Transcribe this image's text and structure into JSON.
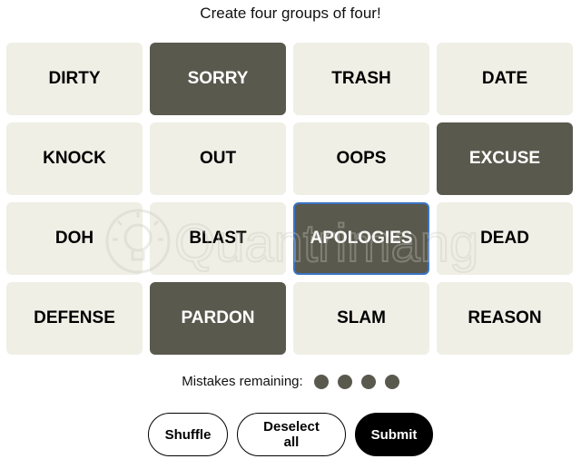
{
  "instruction": "Create four groups of four!",
  "tiles": [
    {
      "label": "DIRTY",
      "selected": false
    },
    {
      "label": "SORRY",
      "selected": true
    },
    {
      "label": "TRASH",
      "selected": false
    },
    {
      "label": "DATE",
      "selected": false
    },
    {
      "label": "KNOCK",
      "selected": false
    },
    {
      "label": "OUT",
      "selected": false
    },
    {
      "label": "OOPS",
      "selected": false
    },
    {
      "label": "EXCUSE",
      "selected": true
    },
    {
      "label": "DOH",
      "selected": false
    },
    {
      "label": "BLAST",
      "selected": false
    },
    {
      "label": "APOLOGIES",
      "selected": true,
      "focused": true
    },
    {
      "label": "DEAD",
      "selected": false
    },
    {
      "label": "DEFENSE",
      "selected": false
    },
    {
      "label": "PARDON",
      "selected": true
    },
    {
      "label": "SLAM",
      "selected": false
    },
    {
      "label": "REASON",
      "selected": false
    }
  ],
  "mistakes": {
    "label": "Mistakes remaining:",
    "remaining": 4
  },
  "buttons": {
    "shuffle": "Shuffle",
    "deselect_all": "Deselect all",
    "submit": "Submit"
  },
  "watermark": {
    "text": "Quantrimang"
  },
  "colors": {
    "tile_default": "#efefe6",
    "tile_selected": "#5a594e",
    "focus_border": "#3b74c4",
    "dot": "#5a594e"
  }
}
